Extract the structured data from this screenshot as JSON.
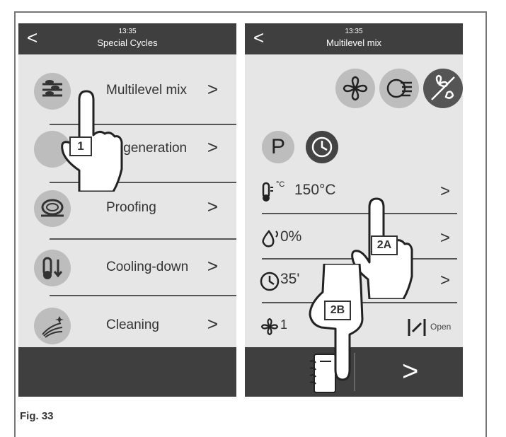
{
  "panel1": {
    "time": "13:35",
    "title": "Special Cycles",
    "items": [
      {
        "label": "Multilevel mix",
        "icon": "multilevel-icon"
      },
      {
        "label": "Regeneration",
        "icon": "regeneration-icon"
      },
      {
        "label": "Proofing",
        "icon": "proofing-icon"
      },
      {
        "label": "Cooling-down",
        "icon": "cooling-down-icon"
      },
      {
        "label": "Cleaning",
        "icon": "cleaning-icon"
      }
    ],
    "chevron": ">",
    "back": "<",
    "hand_tag": "1"
  },
  "panel2": {
    "time": "13:35",
    "title": "Multilevel mix",
    "back": "<",
    "program_letter": "P",
    "temperature": "150°C",
    "temperature_unit": "°C",
    "humidity": "0%",
    "time_value": "35'",
    "fan_value": "1",
    "damper_label": "Open",
    "chevron": ">",
    "next": ">",
    "tag_2a": "2A",
    "tag_2b": "2B"
  },
  "figure_label": "Fig. 33",
  "colors": {
    "header": "#3f3f3f",
    "panel": "#e6e6e6",
    "icon_bg": "#bdbdbd",
    "active_icon": "#555555"
  }
}
